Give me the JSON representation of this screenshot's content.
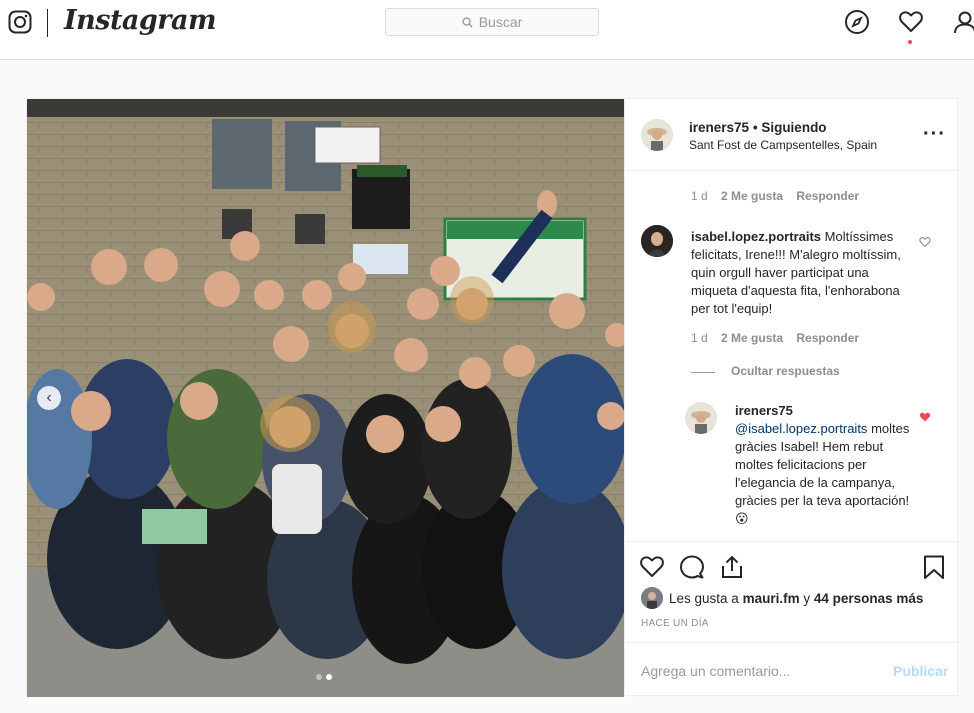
{
  "nav": {
    "brand": "Instagram",
    "search_placeholder": "Buscar",
    "icons": [
      "instagram-glyph-icon",
      "search-icon",
      "explore-compass-icon",
      "activity-heart-icon",
      "profile-icon"
    ],
    "notification_dot_color": "#ed4956"
  },
  "post": {
    "carousel": {
      "slide_count": 2,
      "active_slide": 2
    },
    "header": {
      "username": "ireners75",
      "separator": "•",
      "follow_state": "Siguiendo",
      "location": "Sant Fost de Campsentelles, Spain"
    },
    "comments": [
      {
        "meta": {
          "age": "1 d",
          "likes": "2 Me gusta",
          "reply": "Responder"
        }
      },
      {
        "username": "isabel.lopez.portraits",
        "text": "Moltíssimes felicitats, Irene!!! M'alegro moltíssim, quin orgull haver participat una miqueta d'aquesta fita, l'enhorabona per tot l'equip!",
        "meta": {
          "age": "1 d",
          "likes": "2 Me gusta",
          "reply": "Responder"
        },
        "hide_replies": "Ocultar respuestas",
        "reply": {
          "username": "ireners75",
          "mention": "@isabel.lopez.portraits",
          "text": "moltes gràcies Isabel! Hem rebut moltes felicitacions per l'elegancia de la campanya, gràcies per la teva aportación! 😮",
          "liked": true,
          "like_color": "#ed4956"
        }
      }
    ],
    "actions": {
      "icons": [
        "like-heart-icon",
        "comment-icon",
        "share-icon",
        "save-bookmark-icon"
      ],
      "likes_prefix": "Les gusta a",
      "likes_user": "mauri.fm",
      "likes_mid": "y",
      "likes_count": "44 personas más",
      "date": "HACE UN DÍA"
    },
    "add_comment": {
      "placeholder": "Agrega un comentario...",
      "publish": "Publicar",
      "publish_color": "#b3dbff"
    }
  }
}
